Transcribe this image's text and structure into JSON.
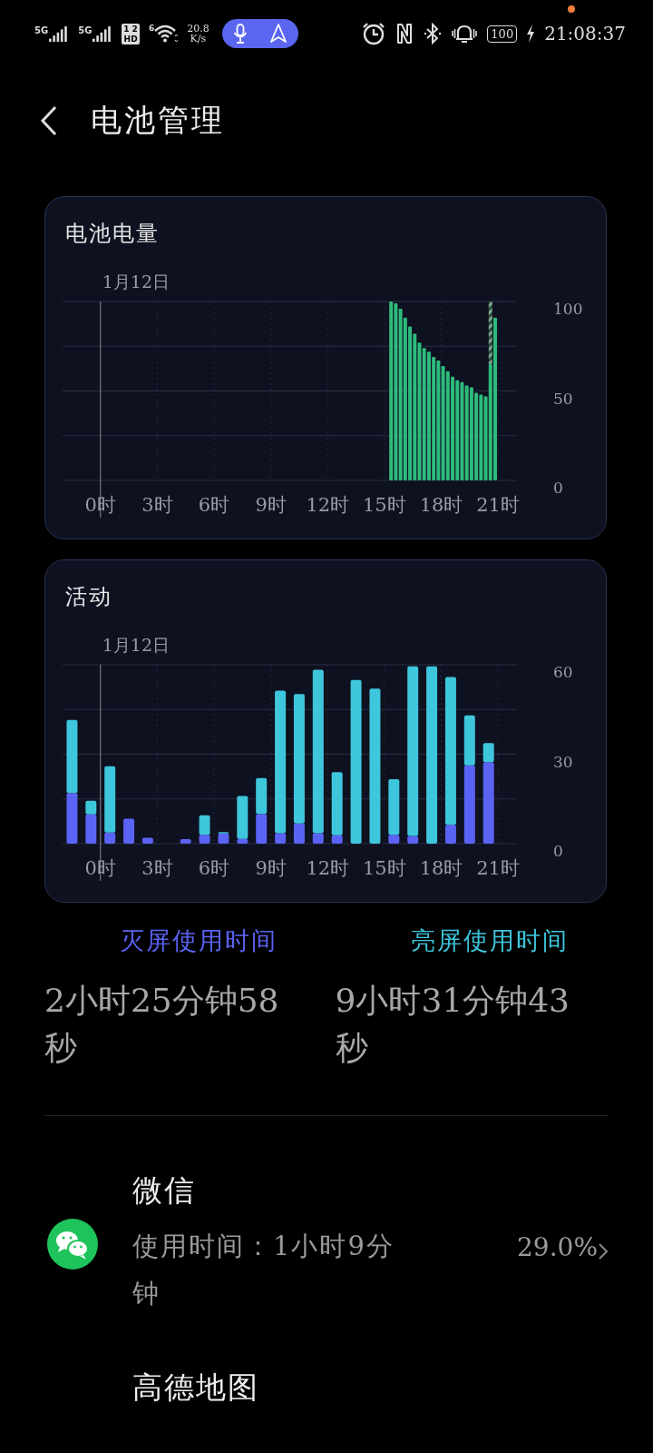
{
  "status_bar": {
    "sim_labels": [
      "5G",
      "5G"
    ],
    "hd_badge": [
      "1",
      "2",
      "HD"
    ],
    "wifi_label": "6",
    "speed": [
      "20.8",
      "K/s"
    ],
    "battery": "100",
    "time": "21:08:37",
    "notification_dot": true
  },
  "header": {
    "title": "电池管理"
  },
  "battery_card": {
    "title": "电池电量",
    "date_label": "1月12日",
    "charging": true,
    "chart_data": {
      "type": "bar",
      "grid": true,
      "xlim": [
        -2,
        22
      ],
      "ylim": [
        0,
        100
      ],
      "yticks": [
        0,
        50,
        100
      ],
      "xticks": [
        {
          "value": 0,
          "label": "0时"
        },
        {
          "value": 3,
          "label": "3时"
        },
        {
          "value": 6,
          "label": "6时"
        },
        {
          "value": 9,
          "label": "9时"
        },
        {
          "value": 12,
          "label": "12时"
        },
        {
          "value": 15,
          "label": "15时"
        },
        {
          "value": 18,
          "label": "18时"
        },
        {
          "value": 21,
          "label": "21时"
        }
      ],
      "x": [
        15.35,
        15.6,
        15.85,
        16.1,
        16.35,
        16.6,
        16.85,
        17.1,
        17.35,
        17.6,
        17.85,
        18.1,
        18.35,
        18.6,
        18.85,
        19.1,
        19.35,
        19.6,
        19.85,
        20.1,
        20.35,
        20.6,
        20.85
      ],
      "values": [
        100,
        99,
        96,
        91,
        86,
        82,
        77,
        74,
        72,
        69,
        67,
        64,
        61,
        58,
        56,
        55,
        53,
        52,
        49,
        48,
        47,
        65,
        91
      ]
    }
  },
  "activity_card": {
    "title": "活动",
    "date_label": "1月12日",
    "chart_data": {
      "type": "bar",
      "grid": true,
      "stacked": true,
      "xlim": [
        -2,
        22
      ],
      "ylim": [
        0,
        60
      ],
      "yticks": [
        0,
        30,
        60
      ],
      "xticks": [
        {
          "value": 0,
          "label": "0时"
        },
        {
          "value": 3,
          "label": "3时"
        },
        {
          "value": 6,
          "label": "6时"
        },
        {
          "value": 9,
          "label": "9时"
        },
        {
          "value": 12,
          "label": "12时"
        },
        {
          "value": 15,
          "label": "15时"
        },
        {
          "value": 18,
          "label": "18时"
        },
        {
          "value": 21,
          "label": "21时"
        }
      ],
      "x": [
        -1.5,
        -0.5,
        0.5,
        1.5,
        2.5,
        3.5,
        4.5,
        5.5,
        6.5,
        7.5,
        8.5,
        9.5,
        10.5,
        11.5,
        12.5,
        13.5,
        14.5,
        15.5,
        16.5,
        17.5,
        18.5,
        19.5,
        20.5
      ],
      "series": [
        {
          "name": "灭屏使用时间",
          "color": "#5b63f5",
          "values": [
            17,
            9.8,
            3.7,
            8.4,
            2,
            0,
            1.5,
            3,
            3.4,
            1.6,
            10,
            3.5,
            6.8,
            3.5,
            2.8,
            0,
            0,
            3,
            2.6,
            0,
            6.3,
            26.3,
            27.3
          ]
        },
        {
          "name": "亮屏使用时间",
          "color": "#3ec6dc",
          "values": [
            24.5,
            4.6,
            22.3,
            0,
            0,
            0,
            0,
            6.5,
            0.5,
            14.4,
            12,
            47.8,
            43.4,
            54.8,
            21.2,
            54.9,
            52,
            18.6,
            56.9,
            59.5,
            49.6,
            16.7,
            6.4
          ]
        }
      ]
    }
  },
  "usage_totals": [
    "2小时25分钟58秒",
    "9小时31分钟43秒"
  ],
  "apps": [
    {
      "kind": "chat",
      "name": "微信",
      "usage": "使用时间：1小时9分钟",
      "share": "29.0%"
    },
    {
      "kind": "cut",
      "name": "高德地图"
    }
  ]
}
